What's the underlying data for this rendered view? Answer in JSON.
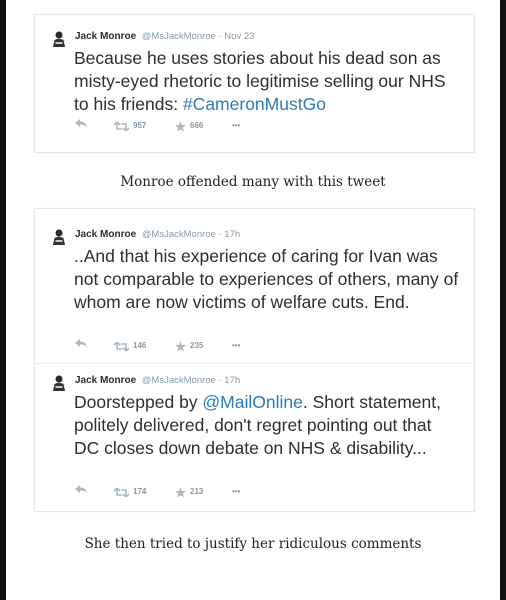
{
  "tweets": [
    {
      "author": "Jack Monroe",
      "handle": "@MsJackMonroe",
      "sep": "·",
      "time": "Nov 23",
      "text_pre": "Because he uses stories about his dead son as misty-eyed rhetoric to legitimise selling our NHS to his friends: ",
      "hashtag": "#CameronMustGo",
      "retweets": "957",
      "favorites": "666",
      "more": "•••"
    },
    {
      "author": "Jack Monroe",
      "handle": "@MsJackMonroe",
      "sep": "·",
      "time": "17h",
      "text": "..And that his experience of caring for Ivan was not comparable to experiences of others, many of whom are now victims of welfare cuts. End.",
      "retweets": "146",
      "favorites": "235",
      "more": "•••"
    },
    {
      "author": "Jack Monroe",
      "handle": "@MsJackMonroe",
      "sep": "·",
      "time": "17h",
      "text_pre": "Doorstepped by ",
      "mention": "@MailOnline",
      "text_post": ". Short statement, politely delivered, don't regret pointing out that DC closes down debate on NHS & disability...",
      "retweets": "174",
      "favorites": "213",
      "more": "•••"
    }
  ],
  "captions": {
    "first": "Monroe offended many with this tweet",
    "second": "She then tried to justify her ridiculous comments"
  },
  "colors": {
    "link": "#2b7bb9",
    "text": "#292f33",
    "meta": "#8899a6",
    "edge": "#111111"
  },
  "icons": [
    "avatar",
    "reply-icon",
    "retweet-icon",
    "favorite-icon",
    "more-icon"
  ]
}
